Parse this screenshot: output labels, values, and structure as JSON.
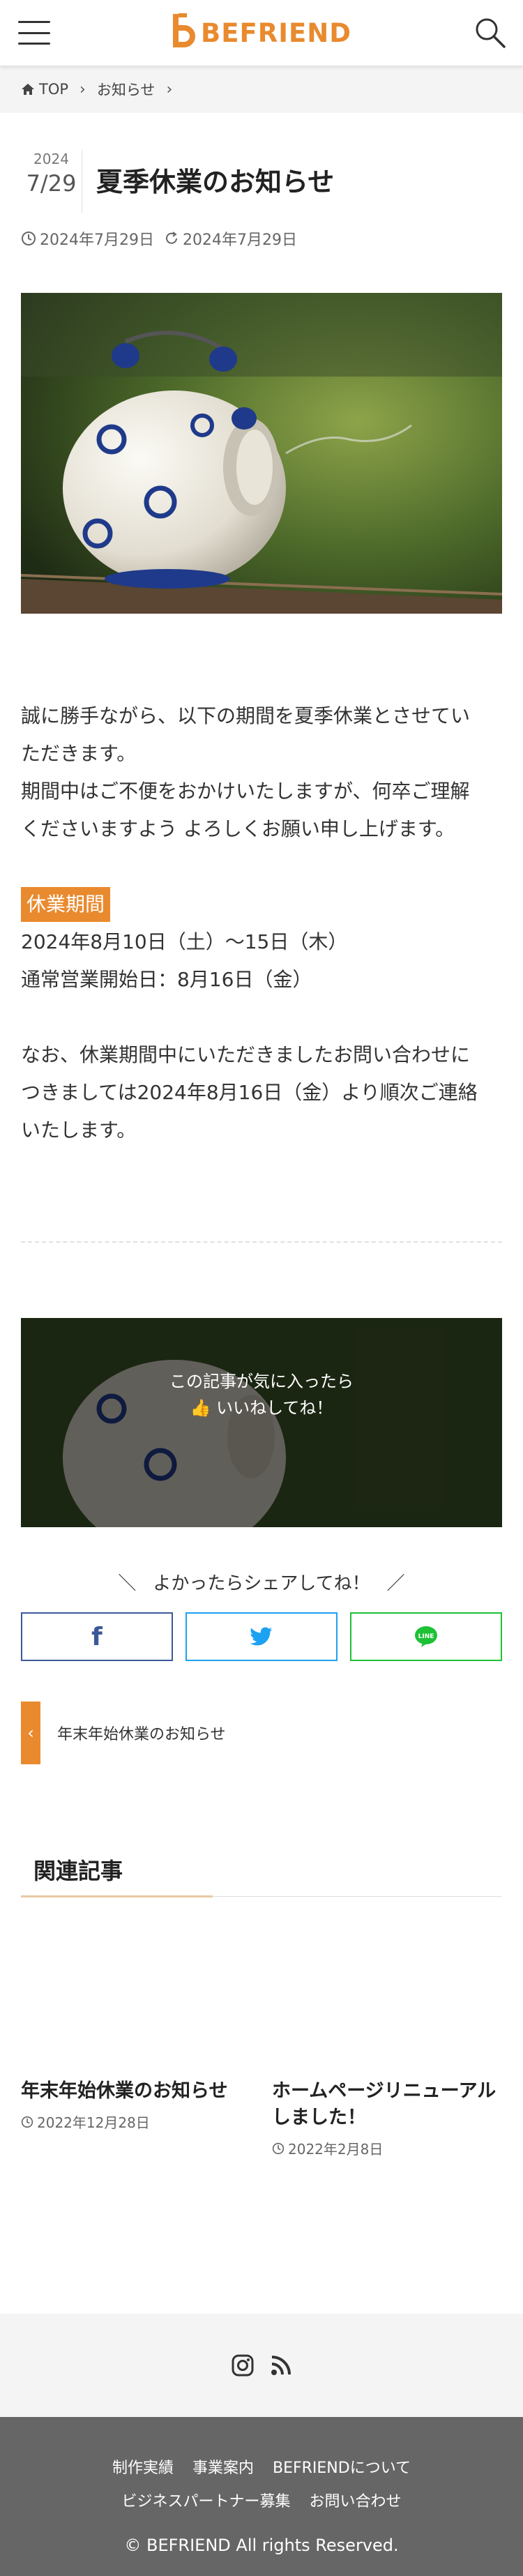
{
  "header": {
    "logo_text": "BEFRIEND",
    "accent_color": "#e98a2e"
  },
  "breadcrumb": {
    "home": "TOP",
    "category": "お知らせ"
  },
  "post": {
    "year": "2024",
    "month_day": "7/29",
    "title": "夏季休業のお知らせ",
    "published": "2024年7月29日",
    "updated": "2024年7月29日"
  },
  "content": {
    "line1a": "誠に勝手ながら、以下の期間を夏季休業とさせてい",
    "line1b": "ただきます。",
    "line2a": "期間中はご不便をおかけいたしますが、何卒ご理解",
    "line2b": "くださいますよう よろしくお願い申し上げます。",
    "label": "休業期間",
    "period": "2024年8月10日（土）〜15日（木）",
    "resume": "通常営業開始日：8月16日（金）",
    "note_a": "なお、休業期間中にいただきましたお問い合わせに",
    "note_b": "つきましては2024年8月16日（金）より順次ご連絡",
    "note_c": "いたします。"
  },
  "like_box": {
    "line1": "この記事が気に入ったら",
    "line2": "いいねしてね！"
  },
  "share": {
    "title": "よかったらシェアしてね！",
    "facebook_color": "#3b5998",
    "twitter_color": "#1da1f2",
    "line_color": "#1dc136",
    "line_label": "LINE"
  },
  "prev_post": {
    "title": "年末年始休業のお知らせ"
  },
  "related": {
    "heading": "関連記事",
    "items": [
      {
        "title": "年末年始休業のお知らせ",
        "date": "2022年12月28日"
      },
      {
        "title_a": "ホームページリニューアル",
        "title_b": "しました！",
        "date": "2022年2月8日"
      }
    ]
  },
  "footer": {
    "nav": [
      "制作実績",
      "事業案内",
      "BEFRIENDについて",
      "ビジネスパートナー募集",
      "お問い合わせ"
    ],
    "copyright": "© BEFRIEND All rights Reserved."
  }
}
